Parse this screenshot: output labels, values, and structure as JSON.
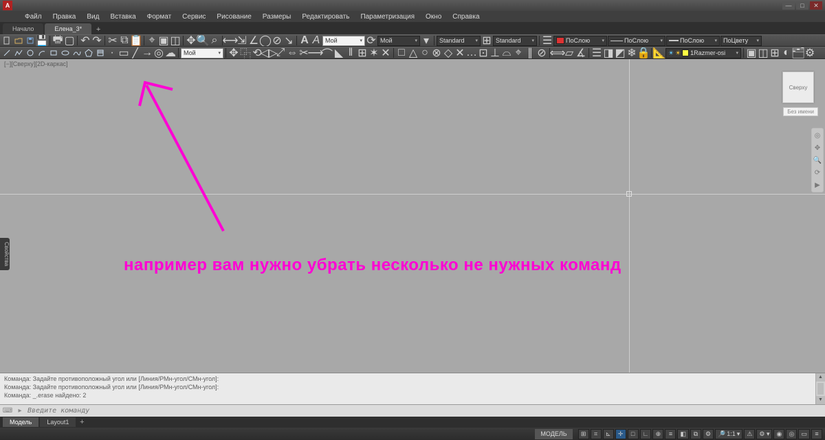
{
  "menu": [
    "Файл",
    "Правка",
    "Вид",
    "Вставка",
    "Формат",
    "Сервис",
    "Рисование",
    "Размеры",
    "Редактировать",
    "Параметризация",
    "Окно",
    "Справка"
  ],
  "file_tabs": {
    "items": [
      {
        "label": "Начало",
        "active": false
      },
      {
        "label": "Елена_3*",
        "active": true
      }
    ]
  },
  "toolbar1": {
    "combo_textstyle": "Мой",
    "combo_style2": "Мой",
    "combo_standard1": "Standard",
    "combo_standard2": "Standard",
    "layer_hint": "ПоСлою",
    "layer_hint2": "ПоСлою",
    "layer_hint3": "ПоСлою",
    "bycolor": "ПоЦвету"
  },
  "toolbar2": {
    "combo_layer": "Мой",
    "dimstyle": "1Razmer-osi"
  },
  "viewport": {
    "label": "[−][Сверху][2D-каркас]",
    "viewcube_face": "Сверху",
    "noname": "Без имени",
    "side_tab": "Свойства"
  },
  "annotation": {
    "text": "например вам нужно убрать несколько не нужных команд"
  },
  "cmdlog": {
    "lines": [
      "Команда: Задайте противоположный угол или [Линия/РМн-угол/СМн-угол]:",
      "Команда: Задайте противоположный угол или [Линия/РМн-угол/СМн-угол]:",
      "Команда: _.erase найдено: 2"
    ],
    "prompt_placeholder": "Введите команду"
  },
  "sheet_tabs": {
    "items": [
      {
        "label": "Модель",
        "active": true
      },
      {
        "label": "Layout1",
        "active": false
      }
    ]
  },
  "status": {
    "mode": "МОДЕЛЬ",
    "scale": "1:1"
  }
}
